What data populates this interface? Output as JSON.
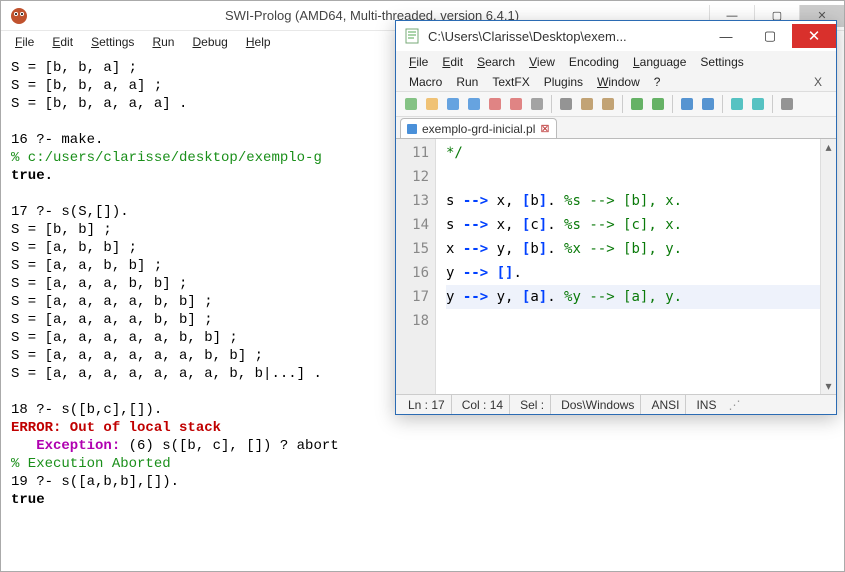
{
  "swi": {
    "title": "SWI-Prolog (AMD64, Multi-threaded, version 6.4.1)",
    "menu": {
      "file": "File",
      "edit": "Edit",
      "settings": "Settings",
      "run": "Run",
      "debug": "Debug",
      "help": "Help"
    },
    "winbtns": {
      "min": "—",
      "max": "▢",
      "close": "✕"
    },
    "lines": [
      {
        "t": "S = [b, b, a] ;"
      },
      {
        "t": "S = [b, b, a, a] ;"
      },
      {
        "t": "S = [b, b, a, a, a] ."
      },
      {
        "t": ""
      },
      {
        "t": "16 ?- make."
      },
      {
        "cls": "c-green",
        "t": "% c:/users/clarisse/desktop/exemplo-g"
      },
      {
        "cls": "c-bold",
        "t": "true."
      },
      {
        "t": ""
      },
      {
        "t": "17 ?- s(S,[])."
      },
      {
        "t": "S = [b, b] ;"
      },
      {
        "t": "S = [a, b, b] ;"
      },
      {
        "t": "S = [a, a, b, b] ;"
      },
      {
        "t": "S = [a, a, a, b, b] ;"
      },
      {
        "t": "S = [a, a, a, a, b, b] ;"
      },
      {
        "t": "S = [a, a, a, a, b, b] ;"
      },
      {
        "t": "S = [a, a, a, a, a, b, b] ;"
      },
      {
        "t": "S = [a, a, a, a, a, a, b, b] ;"
      },
      {
        "t": "S = [a, a, a, a, a, a, a, b, b|...] ."
      },
      {
        "t": ""
      },
      {
        "t": "18 ?- s([b,c],[])."
      },
      {
        "cls": "c-red",
        "t": "ERROR: Out of local stack"
      },
      {
        "segments": [
          {
            "cls": "c-mag",
            "t": "   Exception:"
          },
          {
            "t": " (6) s([b, c], []) ? abort"
          }
        ]
      },
      {
        "cls": "c-green",
        "t": "% Execution Aborted"
      },
      {
        "t": "19 ?- s([a,b,b],[])."
      },
      {
        "cls": "c-bold",
        "t": "true"
      }
    ]
  },
  "npp": {
    "title": "C:\\Users\\Clarisse\\Desktop\\exem...",
    "winbtns": {
      "min": "—",
      "max": "▢",
      "close": "✕"
    },
    "menu1": {
      "file": "File",
      "edit": "Edit",
      "search": "Search",
      "view": "View",
      "encoding": "Encoding",
      "language": "Language",
      "settings": "Settings"
    },
    "menu2": {
      "macro": "Macro",
      "run": "Run",
      "textfx": "TextFX",
      "plugins": "Plugins",
      "window": "Window",
      "q": "?",
      "x": "X"
    },
    "toolbar_icons": [
      "new-file-icon",
      "open-icon",
      "save-icon",
      "save-all-icon",
      "close-icon",
      "close-all-icon",
      "print-icon",
      "sep",
      "cut-icon",
      "copy-icon",
      "paste-icon",
      "sep",
      "undo-icon",
      "redo-icon",
      "sep",
      "find-icon",
      "replace-icon",
      "sep",
      "zoom-in-icon",
      "zoom-out-icon",
      "sep",
      "more-icon"
    ],
    "tab": {
      "name": "exemplo-grd-inicial.pl",
      "close": "⊠"
    },
    "gutter": [
      "11",
      "12",
      "13",
      "14",
      "15",
      "16",
      "17",
      "18"
    ],
    "code": [
      {
        "segments": [
          {
            "cls": "kw-green",
            "t": "*/"
          }
        ]
      },
      {
        "segments": [
          {
            "t": ""
          }
        ]
      },
      {
        "segments": [
          {
            "t": "s "
          },
          {
            "cls": "kw-blue",
            "t": "-->"
          },
          {
            "t": " x, "
          },
          {
            "cls": "kw-blue",
            "t": "["
          },
          {
            "t": "b"
          },
          {
            "cls": "kw-blue",
            "t": "]"
          },
          {
            "t": ". "
          },
          {
            "cls": "kw-green",
            "t": "%s --> [b], x."
          }
        ]
      },
      {
        "segments": [
          {
            "t": "s "
          },
          {
            "cls": "kw-blue",
            "t": "-->"
          },
          {
            "t": " x, "
          },
          {
            "cls": "kw-blue",
            "t": "["
          },
          {
            "t": "c"
          },
          {
            "cls": "kw-blue",
            "t": "]"
          },
          {
            "t": ". "
          },
          {
            "cls": "kw-green",
            "t": "%s --> [c], x."
          }
        ]
      },
      {
        "segments": [
          {
            "t": "x "
          },
          {
            "cls": "kw-blue",
            "t": "-->"
          },
          {
            "t": " y, "
          },
          {
            "cls": "kw-blue",
            "t": "["
          },
          {
            "t": "b"
          },
          {
            "cls": "kw-blue",
            "t": "]"
          },
          {
            "t": ". "
          },
          {
            "cls": "kw-green",
            "t": "%x --> [b], y."
          }
        ]
      },
      {
        "segments": [
          {
            "t": "y "
          },
          {
            "cls": "kw-blue",
            "t": "-->"
          },
          {
            "t": " "
          },
          {
            "cls": "kw-blue",
            "t": "[]"
          },
          {
            "t": "."
          }
        ]
      },
      {
        "hl": true,
        "segments": [
          {
            "t": "y "
          },
          {
            "cls": "kw-blue",
            "t": "-->"
          },
          {
            "t": " y, "
          },
          {
            "cls": "kw-blue",
            "t": "["
          },
          {
            "t": "a"
          },
          {
            "cls": "kw-blue",
            "t": "]"
          },
          {
            "t": ". "
          },
          {
            "cls": "kw-green",
            "t": "%y --> [a], y."
          }
        ]
      },
      {
        "segments": [
          {
            "t": ""
          }
        ]
      }
    ],
    "status": {
      "ln": "Ln : 17",
      "col": "Col : 14",
      "sel": "Sel :",
      "eol": "Dos\\Windows",
      "enc": "ANSI",
      "ins": "INS"
    },
    "scroll": {
      "up": "▴",
      "down": "▾"
    }
  }
}
